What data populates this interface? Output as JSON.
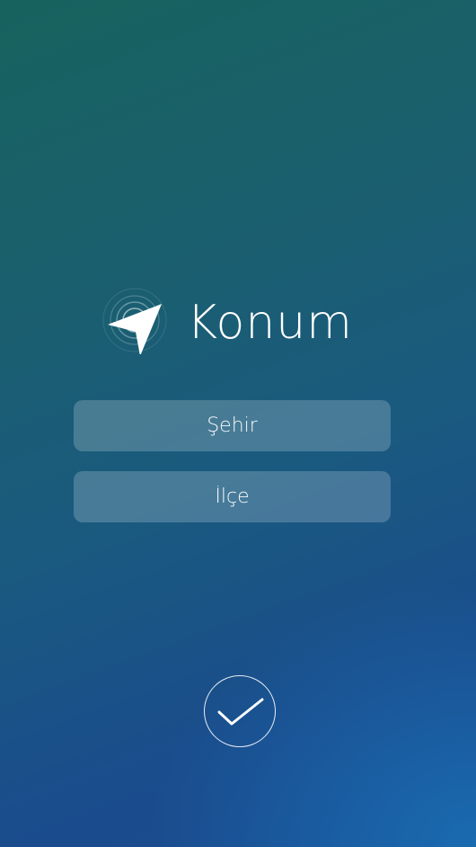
{
  "app": {
    "title": "Konum",
    "logo_icon": "paper-plane-radar-icon"
  },
  "form": {
    "city_placeholder": "Şehir",
    "district_placeholder": "İlçe"
  },
  "actions": {
    "confirm_icon": "checkmark-icon"
  },
  "colors": {
    "gradient_top": "#17625e",
    "gradient_bottom": "#1a4a90",
    "accent_bottom_right": "#1a6eb4",
    "text": "#ffffff"
  }
}
